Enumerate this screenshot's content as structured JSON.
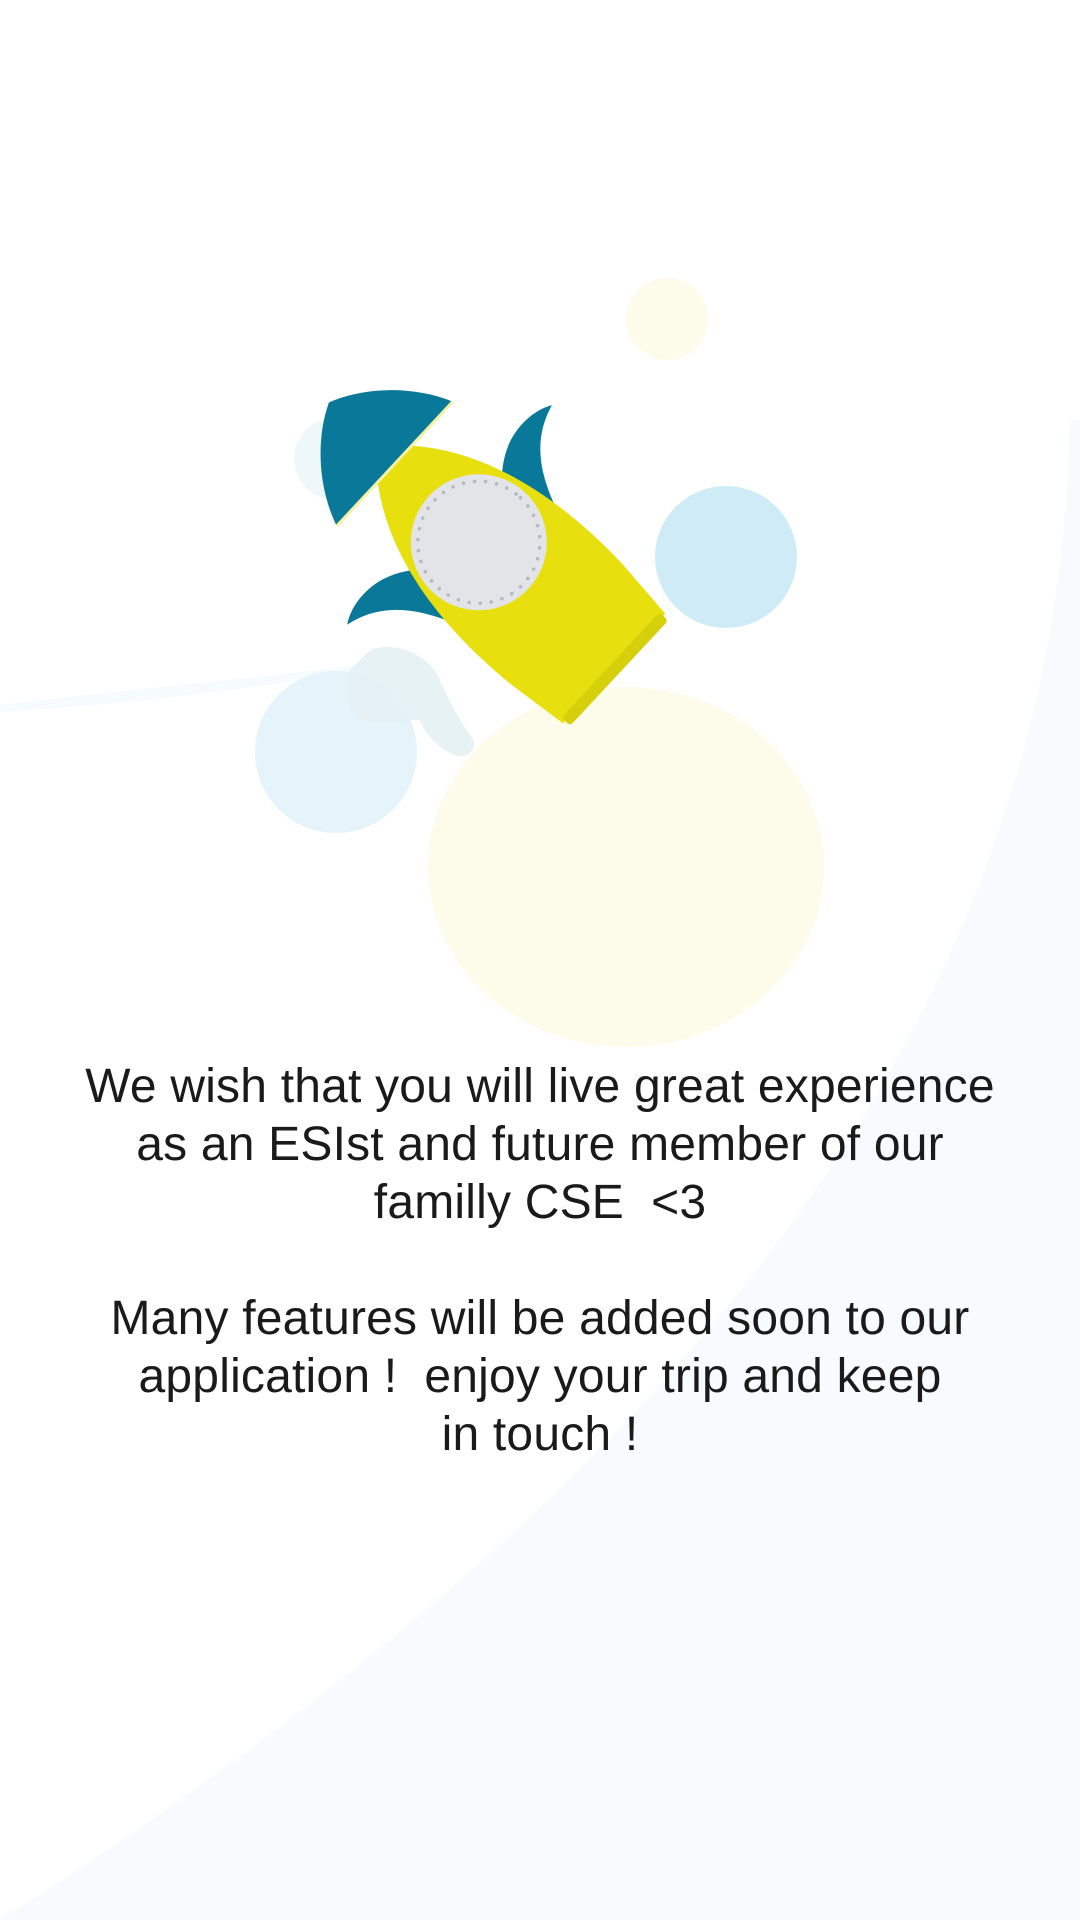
{
  "message": {
    "paragraph1": [
      "We wish that you will live great experience",
      "as an ESIst and future member of our",
      "familly CSE  <3"
    ],
    "paragraph2": [
      "Many features will be added soon to our",
      "application !  enjoy your trip and keep",
      "in touch !"
    ]
  },
  "colors": {
    "rocket_body": "#e8df0e",
    "rocket_fins": "#0a7898",
    "porthole": "#e3e4e8",
    "bubble_blue": "#cfebf6",
    "bubble_pale": "#fdfbea",
    "background_curve": "#f7fbfd",
    "text": "#1a1a1a"
  },
  "illustration": {
    "name": "rocket-illustration"
  }
}
